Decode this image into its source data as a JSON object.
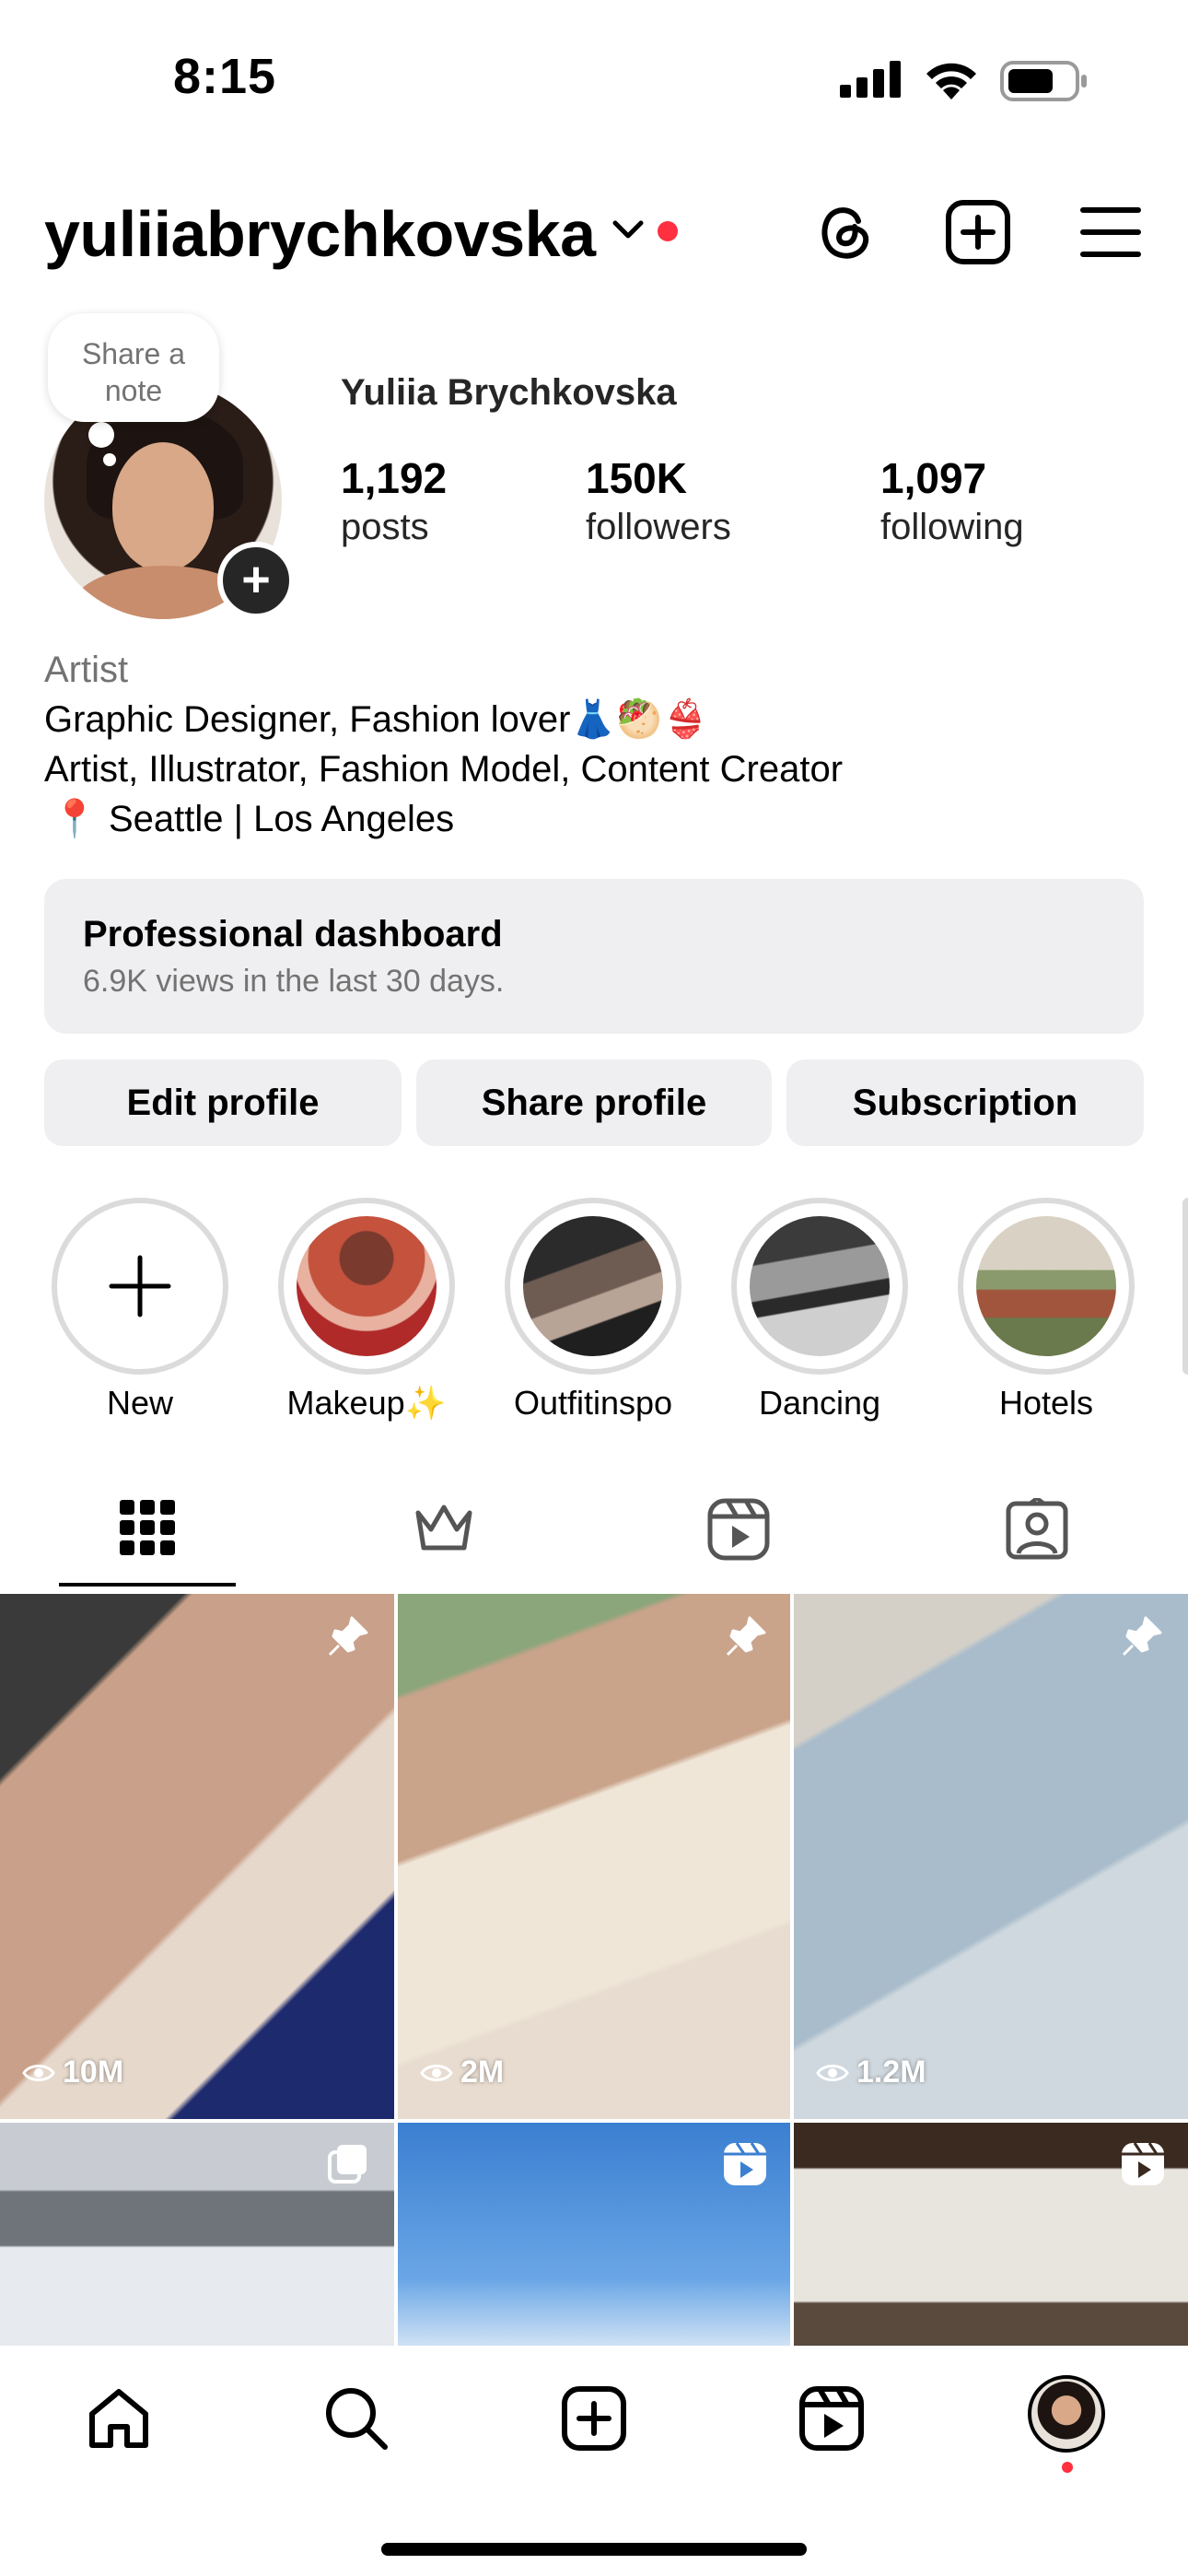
{
  "status_bar": {
    "time": "8:15"
  },
  "header": {
    "username": "yuliiabrychkovska"
  },
  "note": {
    "text_line1": "Share a",
    "text_line2": "note"
  },
  "profile": {
    "full_name": "Yuliia Brychkovska",
    "stats": [
      {
        "value": "1,192",
        "label": "posts"
      },
      {
        "value": "150K",
        "label": "followers"
      },
      {
        "value": "1,097",
        "label": "following"
      }
    ]
  },
  "bio": {
    "category": "Artist",
    "line1": "Graphic Designer, Fashion lover👗🥙👙",
    "line2": "Artist, Illustrator, Fashion Model, Content Creator",
    "line3_pin": "📍",
    "line3": "Seattle | Los Angeles"
  },
  "dashboard": {
    "title": "Professional dashboard",
    "subtitle": "6.9K views in the last 30 days."
  },
  "buttons": {
    "edit": "Edit profile",
    "share": "Share profile",
    "subscription": "Subscription"
  },
  "highlights": [
    {
      "label": "New"
    },
    {
      "label": "Makeup✨"
    },
    {
      "label": "Outfitinspo"
    },
    {
      "label": "Dancing"
    },
    {
      "label": "Hotels"
    }
  ],
  "tabs": [
    "grid-icon",
    "crown-icon",
    "reels-icon",
    "tagged-icon"
  ],
  "grid_views": [
    "10M",
    "2M",
    "1.2M"
  ],
  "colors": {
    "notification_dot": "#ff3040",
    "button_bg": "#efeff1",
    "secondary_text": "#737373"
  }
}
